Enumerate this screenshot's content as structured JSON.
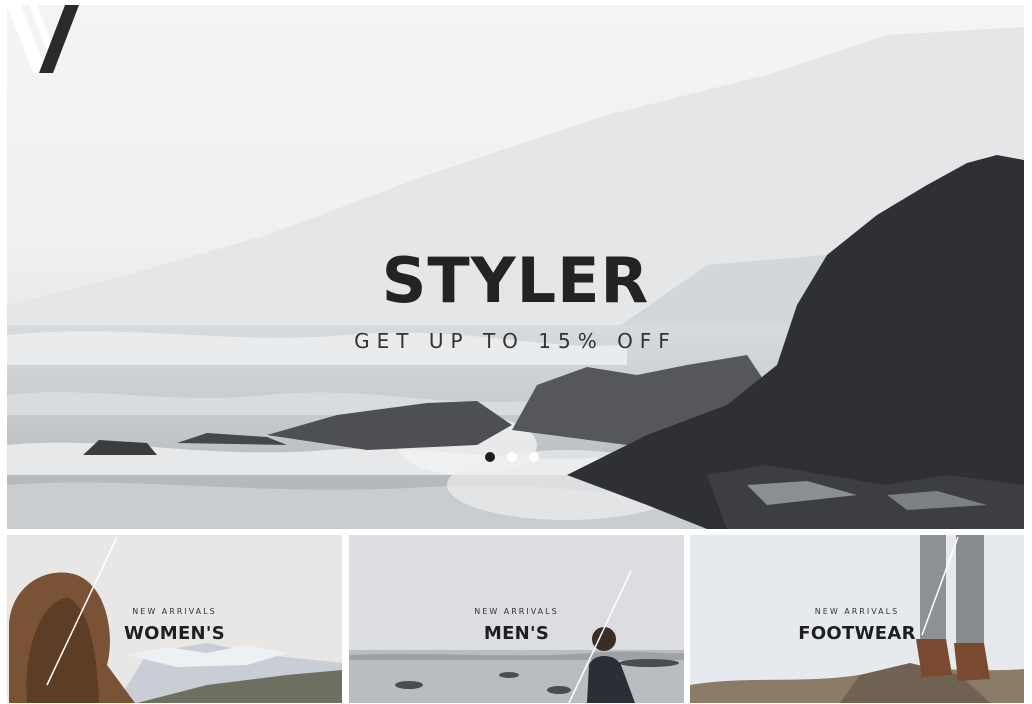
{
  "hero": {
    "brand_name": "STYLER",
    "tagline": "GET UP TO 15% OFF",
    "logo_icon": "styler-v-logo-icon",
    "slides": 3,
    "active_slide": 1
  },
  "categories": [
    {
      "eyebrow": "NEW ARRIVALS",
      "title": "WOMEN'S"
    },
    {
      "eyebrow": "NEW ARRIVALS",
      "title": "MEN'S"
    },
    {
      "eyebrow": "NEW ARRIVALS",
      "title": "FOOTWEAR"
    }
  ],
  "colors": {
    "text_dark": "#232323",
    "dot_active": "#1d1d1d",
    "dot_inactive": "#ffffff"
  }
}
